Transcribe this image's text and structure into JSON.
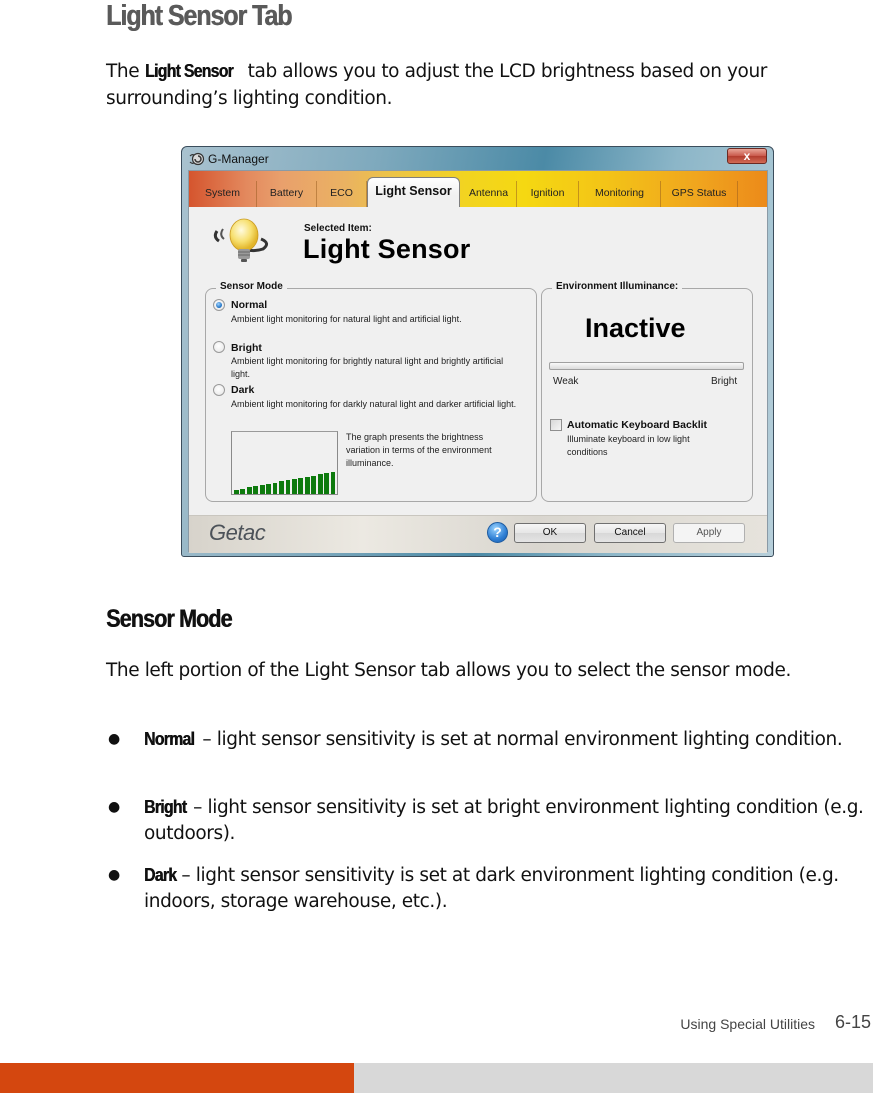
{
  "document": {
    "heading": "Light Sensor Tab",
    "intro": {
      "prefix": "The ",
      "keyword": "Light Sensor",
      "suffix": " tab allows you to adjust the LCD brightness based on your surrounding’s lighting condition."
    },
    "section_heading": "Sensor Mode",
    "section_intro": "The left portion of the Light Sensor tab allows you to select the sensor mode.",
    "bullets": [
      {
        "keyword": "Normal",
        "text": " – light sensor sensitivity is set at normal environment lighting condition."
      },
      {
        "keyword": "Bright",
        "text": " – light sensor sensitivity is set at bright environment lighting condition (e.g. outdoors)."
      },
      {
        "keyword": "Dark",
        "text": " – light sensor sensitivity is set at dark environment lighting condition (e.g. indoors, storage warehouse, etc.)."
      }
    ],
    "footer": {
      "chapter": "Using Special Utilities",
      "page": "6-15"
    },
    "colors": {
      "accent_orange": "#d4470f",
      "footer_gray": "#d8d8d8",
      "heading_gray": "#5a5a5a"
    }
  },
  "window": {
    "title": "G-Manager",
    "app_icon": "g-manager-icon",
    "close_label": "x",
    "tabs": [
      {
        "label": "System",
        "active": false
      },
      {
        "label": "Battery",
        "active": false
      },
      {
        "label": "ECO",
        "active": false
      },
      {
        "label": "Light Sensor",
        "active": true
      },
      {
        "label": "Antenna",
        "active": false
      },
      {
        "label": "Ignition",
        "active": false
      },
      {
        "label": "Monitoring",
        "active": false
      },
      {
        "label": "GPS Status",
        "active": false
      }
    ],
    "selected_item_label": "Selected Item:",
    "selected_item_value": "Light Sensor",
    "sensor_mode": {
      "legend": "Sensor Mode",
      "selected": "Normal",
      "options": [
        {
          "label": "Normal",
          "description": "Ambient light monitoring for natural light and artificial light.",
          "checked": true
        },
        {
          "label": "Bright",
          "description": "Ambient light monitoring for brightly natural light and brightly artificial light.",
          "checked": false
        },
        {
          "label": "Dark",
          "description": "Ambient light monitoring for darkly natural light and darker artificial light.",
          "checked": false
        }
      ],
      "graph_note": "The graph presents the brightness variation in terms of the environment illuminance.",
      "graph_levels": [
        1,
        2,
        3,
        4,
        5,
        6,
        7,
        8,
        9,
        10,
        11,
        12,
        13,
        14,
        15,
        16
      ],
      "graph_color": "#0d7a0d"
    },
    "environment": {
      "legend": "Environment Illuminance:",
      "status": "Inactive",
      "level_percent": 0,
      "scale_min_label": "Weak",
      "scale_max_label": "Bright",
      "keyboard_backlit": {
        "label": "Automatic Keyboard Backlit",
        "description": "Illuminate keyboard in low light conditions",
        "checked": false
      }
    },
    "brand": "Getac",
    "buttons": {
      "help": "?",
      "ok": "OK",
      "cancel": "Cancel",
      "apply": "Apply"
    }
  }
}
